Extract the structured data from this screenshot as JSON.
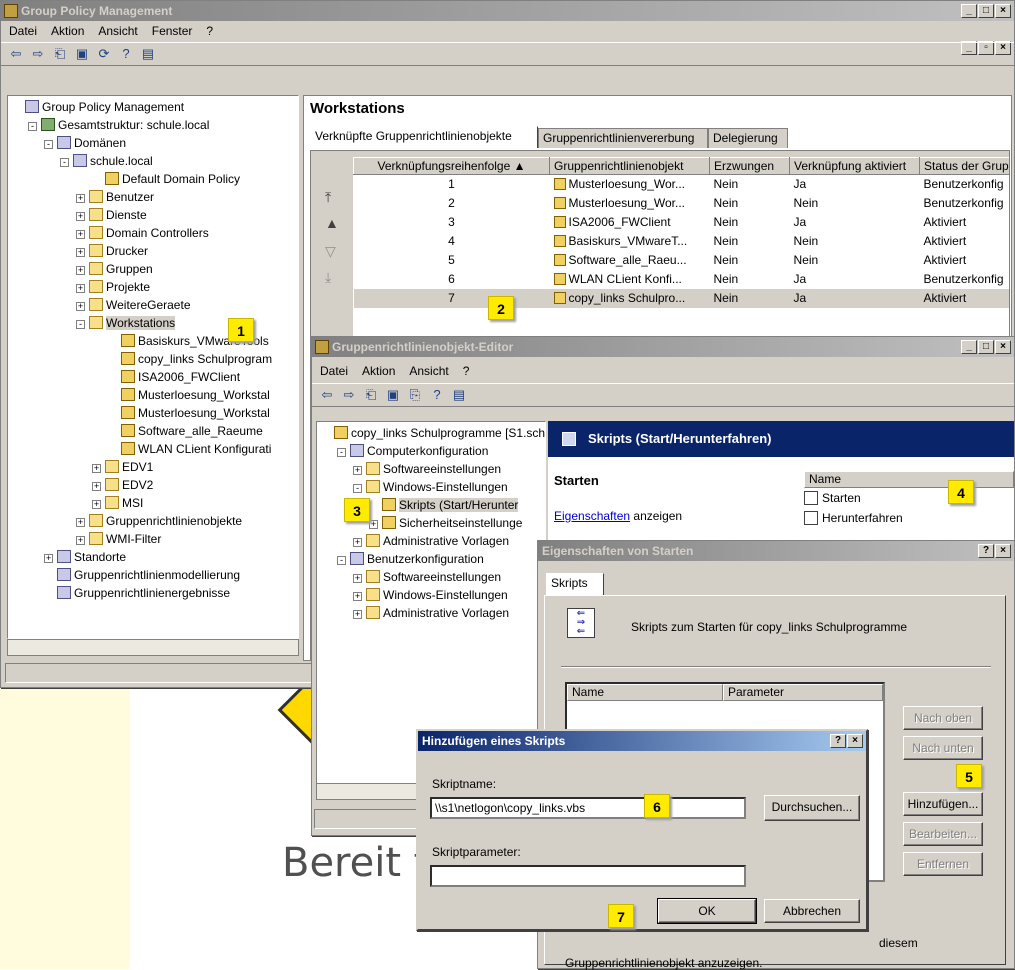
{
  "gpm": {
    "title": "Group Policy Management",
    "menu": [
      "Datei",
      "Aktion",
      "Ansicht",
      "Fenster",
      "?"
    ],
    "tree": [
      {
        "label": "Group Policy Management",
        "indent": 0,
        "icon": "d"
      },
      {
        "label": "Gesamtstruktur: schule.local",
        "indent": 1,
        "icon": "g",
        "pm": "-"
      },
      {
        "label": "Domänen",
        "indent": 2,
        "icon": "d",
        "pm": "-"
      },
      {
        "label": "schule.local",
        "indent": 3,
        "icon": "d",
        "pm": "-"
      },
      {
        "label": "Default Domain Policy",
        "indent": 5,
        "icon": "s"
      },
      {
        "label": "Benutzer",
        "indent": 4,
        "icon": "f",
        "pm": "+"
      },
      {
        "label": "Dienste",
        "indent": 4,
        "icon": "f",
        "pm": "+"
      },
      {
        "label": "Domain Controllers",
        "indent": 4,
        "icon": "f",
        "pm": "+"
      },
      {
        "label": "Drucker",
        "indent": 4,
        "icon": "f",
        "pm": "+"
      },
      {
        "label": "Gruppen",
        "indent": 4,
        "icon": "f",
        "pm": "+"
      },
      {
        "label": "Projekte",
        "indent": 4,
        "icon": "f",
        "pm": "+"
      },
      {
        "label": "WeitereGeraete",
        "indent": 4,
        "icon": "f",
        "pm": "+"
      },
      {
        "label": "Workstations",
        "indent": 4,
        "icon": "f",
        "pm": "-",
        "selected": true
      },
      {
        "label": "Basiskurs_VMwareTools",
        "indent": 6,
        "icon": "s"
      },
      {
        "label": "copy_links Schulprogram",
        "indent": 6,
        "icon": "s"
      },
      {
        "label": "ISA2006_FWClient",
        "indent": 6,
        "icon": "s"
      },
      {
        "label": "Musterloesung_Workstal",
        "indent": 6,
        "icon": "s"
      },
      {
        "label": "Musterloesung_Workstal",
        "indent": 6,
        "icon": "s"
      },
      {
        "label": "Software_alle_Raeume",
        "indent": 6,
        "icon": "s"
      },
      {
        "label": "WLAN CLient Konfigurati",
        "indent": 6,
        "icon": "s"
      },
      {
        "label": "EDV1",
        "indent": 5,
        "icon": "f",
        "pm": "+"
      },
      {
        "label": "EDV2",
        "indent": 5,
        "icon": "f",
        "pm": "+"
      },
      {
        "label": "MSI",
        "indent": 5,
        "icon": "f",
        "pm": "+"
      },
      {
        "label": "Gruppenrichtlinienobjekte",
        "indent": 4,
        "icon": "f",
        "pm": "+"
      },
      {
        "label": "WMI-Filter",
        "indent": 4,
        "icon": "f",
        "pm": "+"
      },
      {
        "label": "Standorte",
        "indent": 2,
        "icon": "d",
        "pm": "+"
      },
      {
        "label": "Gruppenrichtlinienmodellierung",
        "indent": 2,
        "icon": "d"
      },
      {
        "label": "Gruppenrichtlinienergebnisse",
        "indent": 2,
        "icon": "d"
      }
    ],
    "right_title": "Workstations",
    "tabs": [
      "Verknüpfte Gruppenrichtlinienobjekte",
      "Gruppenrichtlinienvererbung",
      "Delegierung"
    ],
    "columns": [
      "Verknüpfungsreihenfolge  ▲",
      "Gruppenrichtlinienobjekt",
      "Erzwungen",
      "Verknüpfung aktiviert",
      "Status der Grup"
    ],
    "rows": [
      [
        "1",
        "Musterloesung_Wor...",
        "Nein",
        "Ja",
        "Benutzerkonfig"
      ],
      [
        "2",
        "Musterloesung_Wor...",
        "Nein",
        "Nein",
        "Benutzerkonfig"
      ],
      [
        "3",
        "ISA2006_FWClient",
        "Nein",
        "Ja",
        "Aktiviert"
      ],
      [
        "4",
        "Basiskurs_VMwareT...",
        "Nein",
        "Nein",
        "Aktiviert"
      ],
      [
        "5",
        "Software_alle_Raeu...",
        "Nein",
        "Nein",
        "Aktiviert"
      ],
      [
        "6",
        "WLAN CLient Konfi...",
        "Nein",
        "Ja",
        "Benutzerkonfig"
      ],
      [
        "7",
        "copy_links Schulpro...",
        "Nein",
        "Ja",
        "Aktiviert"
      ]
    ]
  },
  "gpe": {
    "title": "Gruppenrichtlinienobjekt-Editor",
    "menu": [
      "Datei",
      "Aktion",
      "Ansicht",
      "?"
    ],
    "tree": [
      {
        "label": "copy_links Schulprogramme [S1.sch",
        "indent": 0,
        "icon": "s"
      },
      {
        "label": "Computerkonfiguration",
        "indent": 1,
        "icon": "d",
        "pm": "-"
      },
      {
        "label": "Softwareeinstellungen",
        "indent": 2,
        "icon": "f",
        "pm": "+"
      },
      {
        "label": "Windows-Einstellungen",
        "indent": 2,
        "icon": "f",
        "pm": "-"
      },
      {
        "label": "Skripts (Start/Herunter",
        "indent": 3,
        "icon": "s",
        "selected": true
      },
      {
        "label": "Sicherheitseinstellunge",
        "indent": 3,
        "icon": "s",
        "pm": "+"
      },
      {
        "label": "Administrative Vorlagen",
        "indent": 2,
        "icon": "f",
        "pm": "+"
      },
      {
        "label": "Benutzerkonfiguration",
        "indent": 1,
        "icon": "d",
        "pm": "-"
      },
      {
        "label": "Softwareeinstellungen",
        "indent": 2,
        "icon": "f",
        "pm": "+"
      },
      {
        "label": "Windows-Einstellungen",
        "indent": 2,
        "icon": "f",
        "pm": "+"
      },
      {
        "label": "Administrative Vorlagen",
        "indent": 2,
        "icon": "f",
        "pm": "+"
      }
    ],
    "header": "Skripts (Start/Herunterfahren)",
    "section": "Starten",
    "props_link": "Eigenschaften",
    "props_rest": " anzeigen",
    "name_col": "Name",
    "items": [
      "Starten",
      "Herunterfahren"
    ]
  },
  "props": {
    "title": "Eigenschaften von Starten",
    "tab": "Skripts",
    "description": "Skripts zum Starten für copy_links Schulprogramme",
    "col_name": "Name",
    "col_param": "Parameter",
    "btn_up": "Nach oben",
    "btn_down": "Nach unten",
    "btn_add": "Hinzufügen...",
    "btn_edit": "Bearbeiten...",
    "btn_remove": "Entfernen",
    "footer_right": "diesem",
    "footer_bottom": "Gruppenrichtlinienobjekt anzuzeigen."
  },
  "add": {
    "title": "Hinzufügen eines Skripts",
    "name_label": "Skriptname:",
    "name_value": "\\\\s1\\netlogon\\copy_links.vbs",
    "browse": "Durchsuchen...",
    "param_label": "Skriptparameter:",
    "param_value": "",
    "ok": "OK",
    "cancel": "Abbrechen"
  },
  "background_text": "Bereit f",
  "markers": [
    "1",
    "2",
    "3",
    "4",
    "5",
    "6",
    "7"
  ]
}
